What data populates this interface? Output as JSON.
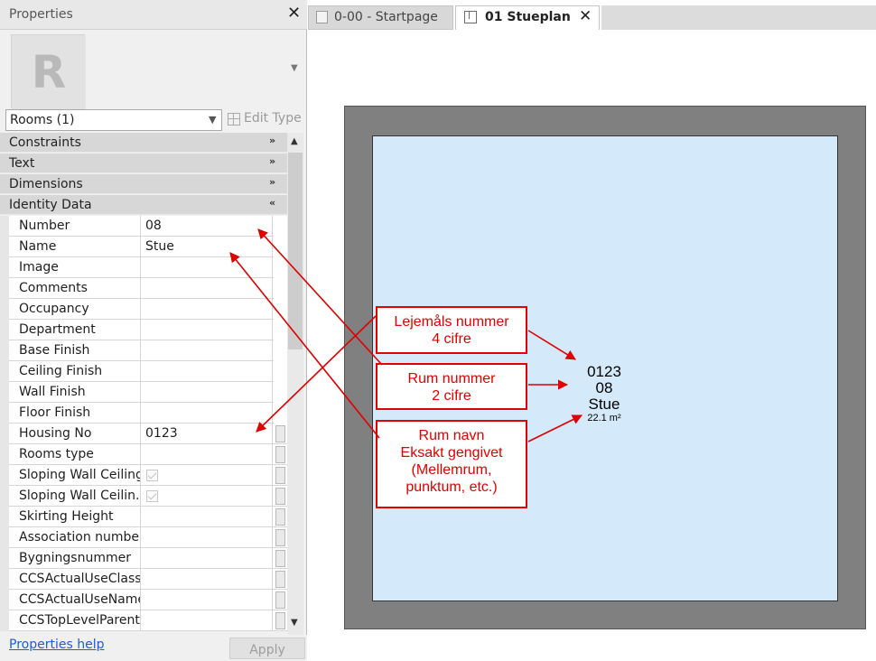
{
  "properties": {
    "title": "Properties",
    "selector": "Rooms (1)",
    "edit_type": "Edit Type",
    "help_link": "Properties help",
    "apply": "Apply",
    "groups": {
      "constraints": "Constraints",
      "text": "Text",
      "dimensions": "Dimensions",
      "identity": "Identity Data"
    },
    "rows": [
      {
        "name": "Number",
        "value": "08"
      },
      {
        "name": "Name",
        "value": "Stue"
      },
      {
        "name": "Image",
        "value": ""
      },
      {
        "name": "Comments",
        "value": ""
      },
      {
        "name": "Occupancy",
        "value": ""
      },
      {
        "name": "Department",
        "value": ""
      },
      {
        "name": "Base Finish",
        "value": ""
      },
      {
        "name": "Ceiling Finish",
        "value": ""
      },
      {
        "name": "Wall Finish",
        "value": ""
      },
      {
        "name": "Floor Finish",
        "value": ""
      },
      {
        "name": "Housing No",
        "value": "0123"
      },
      {
        "name": "Rooms type",
        "value": ""
      },
      {
        "name": "Sloping Wall Ceiling",
        "value": ""
      },
      {
        "name": "Sloping Wall Ceilin...",
        "value": ""
      },
      {
        "name": "Skirting Height",
        "value": ""
      },
      {
        "name": "Association number",
        "value": ""
      },
      {
        "name": "Bygningsnummer",
        "value": ""
      },
      {
        "name": "CCSActualUseClass...",
        "value": ""
      },
      {
        "name": "CCSActualUseName",
        "value": ""
      },
      {
        "name": "CCSTopLevelParent...",
        "value": ""
      }
    ],
    "checked_state": {
      "sloping_wall_ceiling": false,
      "sloping_wall_ceiling_2": false
    }
  },
  "tabs": [
    {
      "label": "0-00 - Startpage",
      "active": false
    },
    {
      "label": "01 Stueplan",
      "active": true
    }
  ],
  "room_tag": {
    "housing_no": "0123",
    "number": "08",
    "name": "Stue",
    "area": "22.1 m²"
  },
  "callouts": {
    "housing": {
      "line1": "Lejemåls nummer",
      "line2": "4 cifre"
    },
    "number": {
      "line1": "Rum nummer",
      "line2": "2 cifre"
    },
    "name": {
      "line1": "Rum navn",
      "line2": "Eksakt gengivet",
      "line3": "(Mellemrum,",
      "line4": "punktum, etc.)"
    }
  },
  "colors": {
    "annotation": "#e00000",
    "room_fill": "#d4e9f9",
    "wall_fill": "#808080",
    "link": "#1a5fd8"
  },
  "icons": {
    "close": "close-icon",
    "revit_logo": "revit-logo-icon",
    "edit_type": "edit-type-icon",
    "startpage_tab": "document-icon",
    "plan_tab": "floor-plan-icon"
  }
}
